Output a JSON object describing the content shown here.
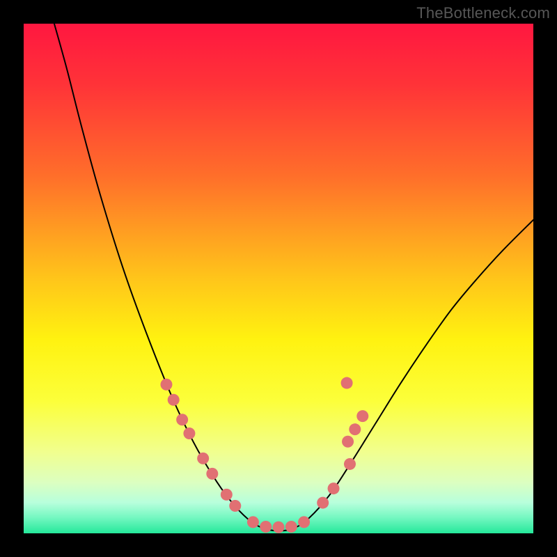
{
  "watermark": "TheBottleneck.com",
  "chart_data": {
    "type": "line",
    "title": "",
    "xlabel": "",
    "ylabel": "",
    "xlim": [
      0,
      1
    ],
    "ylim": [
      0,
      1
    ],
    "background_gradient": {
      "stops": [
        {
          "offset": 0.0,
          "color": "#ff1740"
        },
        {
          "offset": 0.12,
          "color": "#ff3338"
        },
        {
          "offset": 0.3,
          "color": "#ff6f2a"
        },
        {
          "offset": 0.5,
          "color": "#ffc51a"
        },
        {
          "offset": 0.62,
          "color": "#fff210"
        },
        {
          "offset": 0.74,
          "color": "#fcff3a"
        },
        {
          "offset": 0.84,
          "color": "#f1ff8e"
        },
        {
          "offset": 0.9,
          "color": "#dcffc0"
        },
        {
          "offset": 0.94,
          "color": "#b7ffdc"
        },
        {
          "offset": 0.97,
          "color": "#72f7c0"
        },
        {
          "offset": 1.0,
          "color": "#24e89a"
        }
      ]
    },
    "series": [
      {
        "name": "bottleneck-curve",
        "stroke": "#000000",
        "stroke_width": 2,
        "points": [
          {
            "x": 0.06,
            "y": 1.0
          },
          {
            "x": 0.085,
            "y": 0.91
          },
          {
            "x": 0.113,
            "y": 0.8
          },
          {
            "x": 0.15,
            "y": 0.665
          },
          {
            "x": 0.195,
            "y": 0.52
          },
          {
            "x": 0.24,
            "y": 0.395
          },
          {
            "x": 0.29,
            "y": 0.27
          },
          {
            "x": 0.33,
            "y": 0.185
          },
          {
            "x": 0.37,
            "y": 0.115
          },
          {
            "x": 0.405,
            "y": 0.065
          },
          {
            "x": 0.44,
            "y": 0.028
          },
          {
            "x": 0.47,
            "y": 0.01
          },
          {
            "x": 0.5,
            "y": 0.005
          },
          {
            "x": 0.53,
            "y": 0.01
          },
          {
            "x": 0.56,
            "y": 0.03
          },
          {
            "x": 0.6,
            "y": 0.075
          },
          {
            "x": 0.64,
            "y": 0.135
          },
          {
            "x": 0.69,
            "y": 0.215
          },
          {
            "x": 0.74,
            "y": 0.295
          },
          {
            "x": 0.79,
            "y": 0.37
          },
          {
            "x": 0.84,
            "y": 0.44
          },
          {
            "x": 0.89,
            "y": 0.5
          },
          {
            "x": 0.94,
            "y": 0.555
          },
          {
            "x": 1.0,
            "y": 0.615
          }
        ]
      }
    ],
    "markers": {
      "color": "#e17073",
      "radius": 8.5,
      "points": [
        {
          "x": 0.28,
          "y": 0.292
        },
        {
          "x": 0.294,
          "y": 0.262
        },
        {
          "x": 0.311,
          "y": 0.223
        },
        {
          "x": 0.325,
          "y": 0.196
        },
        {
          "x": 0.352,
          "y": 0.147
        },
        {
          "x": 0.37,
          "y": 0.117
        },
        {
          "x": 0.398,
          "y": 0.076
        },
        {
          "x": 0.415,
          "y": 0.054
        },
        {
          "x": 0.45,
          "y": 0.022
        },
        {
          "x": 0.475,
          "y": 0.013
        },
        {
          "x": 0.5,
          "y": 0.012
        },
        {
          "x": 0.525,
          "y": 0.013
        },
        {
          "x": 0.55,
          "y": 0.022
        },
        {
          "x": 0.587,
          "y": 0.06
        },
        {
          "x": 0.608,
          "y": 0.088
        },
        {
          "x": 0.64,
          "y": 0.136
        },
        {
          "x": 0.636,
          "y": 0.18
        },
        {
          "x": 0.65,
          "y": 0.204
        },
        {
          "x": 0.665,
          "y": 0.23
        },
        {
          "x": 0.634,
          "y": 0.295
        }
      ]
    }
  }
}
